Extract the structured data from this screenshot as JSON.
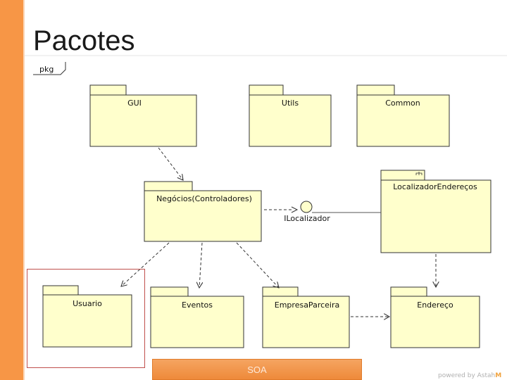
{
  "slide": {
    "title": "Pacotes",
    "footer": "SOA"
  },
  "frame": {
    "label": "pkg"
  },
  "packages": {
    "gui": "GUI",
    "utils": "Utils",
    "common": "Common",
    "localizador": "LocalizadorEndereços",
    "negocios": "Negócios(Controladores)",
    "usuario": "Usuario",
    "eventos": "Eventos",
    "empresa": "EmpresaParceira",
    "endereco": "Endereço"
  },
  "interface": {
    "label": "ILocalizador"
  },
  "watermark": {
    "text": "powered by Astah",
    "logo": "M"
  },
  "colors": {
    "accent": "#f79646",
    "package_fill": "#ffffcc",
    "highlight": "#c0504d"
  }
}
